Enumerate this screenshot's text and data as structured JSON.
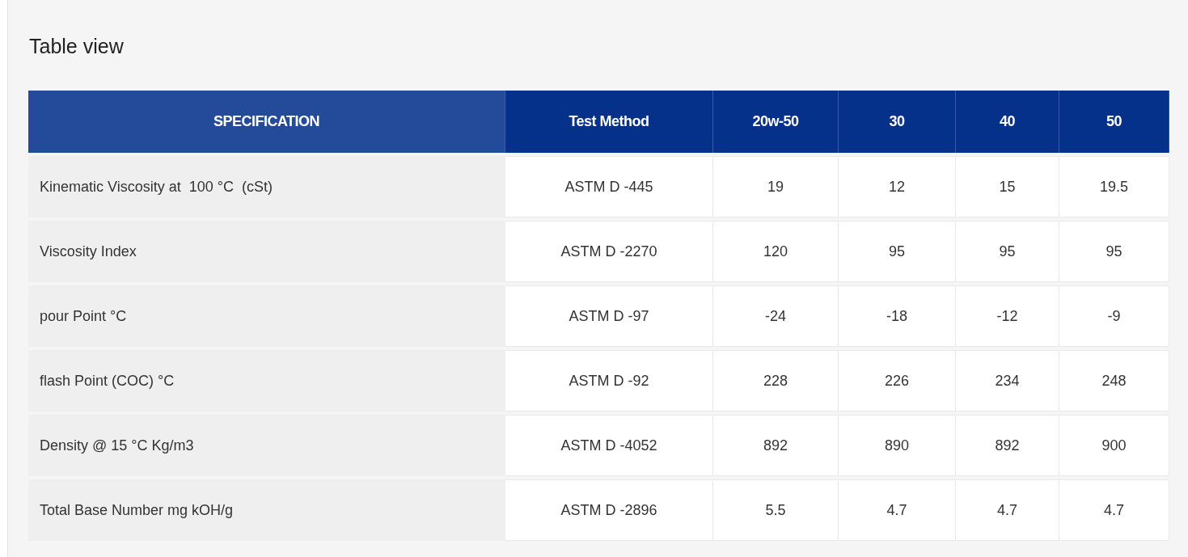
{
  "title": "Table view",
  "table": {
    "columns": [
      "SPECIFICATION",
      "Test Method",
      "20w-50",
      "30",
      "40",
      "50"
    ],
    "rows": [
      [
        "Kinematic Viscosity at  100 °C  (cSt)",
        "ASTM D -445",
        "19",
        "12",
        "15",
        "19.5"
      ],
      [
        "Viscosity Index",
        "ASTM D -2270",
        "120",
        "95",
        "95",
        "95"
      ],
      [
        "pour Point °C",
        "ASTM D -97",
        "-24",
        "-18",
        "-12",
        "-9"
      ],
      [
        "flash Point (COC) °C",
        "ASTM D -92",
        "228",
        "226",
        "234",
        "248"
      ],
      [
        "Density @ 15 °C Kg/m3",
        "ASTM D -4052",
        "892",
        "890",
        "892",
        "900"
      ],
      [
        "Total Base Number mg kOH/g",
        "ASTM D -2896",
        "5.5",
        "4.7",
        "4.7",
        "4.7"
      ]
    ]
  }
}
